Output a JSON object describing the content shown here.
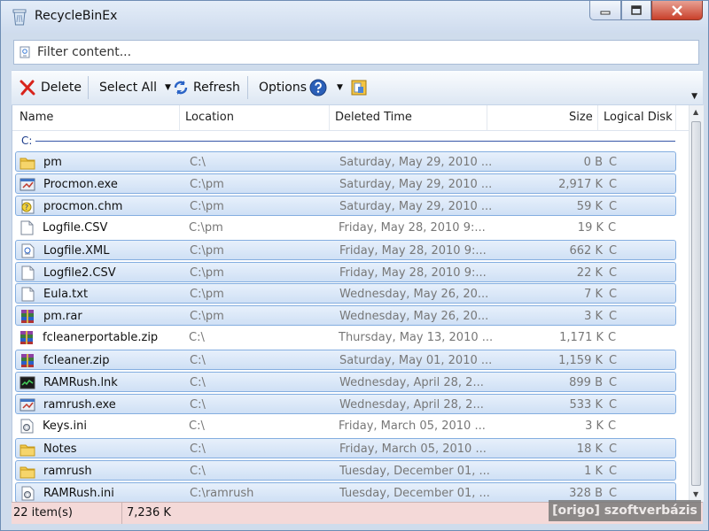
{
  "window": {
    "title": "RecycleBinEx"
  },
  "filter": {
    "placeholder": "Filter content..."
  },
  "toolbar": {
    "delete_label": "Delete",
    "select_all_label": "Select All",
    "refresh_label": "Refresh",
    "options_label": "Options"
  },
  "columns": {
    "name": "Name",
    "location": "Location",
    "deleted_time": "Deleted Time",
    "size": "Size",
    "disk": "Logical Disk"
  },
  "group_label": "C:",
  "files": [
    {
      "name": "pm",
      "location": "C:\\",
      "deleted": "Saturday, May 29, 2010 ...",
      "size": "0 B",
      "disk": "C",
      "icon": "folder-icon",
      "selected": true
    },
    {
      "name": "Procmon.exe",
      "location": "C:\\pm",
      "deleted": "Saturday, May 29, 2010 ...",
      "size": "2,917 K",
      "disk": "C",
      "icon": "exe-icon",
      "selected": true
    },
    {
      "name": "procmon.chm",
      "location": "C:\\pm",
      "deleted": "Saturday, May 29, 2010 ...",
      "size": "59 K",
      "disk": "C",
      "icon": "help-file-icon",
      "selected": true
    },
    {
      "name": "Logfile.CSV",
      "location": "C:\\pm",
      "deleted": "Friday, May 28, 2010 9:...",
      "size": "19 K",
      "disk": "C",
      "icon": "document-icon",
      "selected": false
    },
    {
      "name": "Logfile.XML",
      "location": "C:\\pm",
      "deleted": "Friday, May 28, 2010 9:...",
      "size": "662 K",
      "disk": "C",
      "icon": "xml-file-icon",
      "selected": true
    },
    {
      "name": "Logfile2.CSV",
      "location": "C:\\pm",
      "deleted": "Friday, May 28, 2010 9:...",
      "size": "22 K",
      "disk": "C",
      "icon": "document-icon",
      "selected": true
    },
    {
      "name": "Eula.txt",
      "location": "C:\\pm",
      "deleted": "Wednesday, May 26, 20...",
      "size": "7 K",
      "disk": "C",
      "icon": "document-icon",
      "selected": true
    },
    {
      "name": "pm.rar",
      "location": "C:\\pm",
      "deleted": "Wednesday, May 26, 20...",
      "size": "3 K",
      "disk": "C",
      "icon": "archive-icon",
      "selected": true
    },
    {
      "name": "fcleanerportable.zip",
      "location": "C:\\",
      "deleted": "Thursday, May 13, 2010 ...",
      "size": "1,171 K",
      "disk": "C",
      "icon": "archive-icon",
      "selected": false
    },
    {
      "name": "fcleaner.zip",
      "location": "C:\\",
      "deleted": "Saturday, May 01, 2010 ...",
      "size": "1,159 K",
      "disk": "C",
      "icon": "archive-icon",
      "selected": true
    },
    {
      "name": "RAMRush.lnk",
      "location": "C:\\",
      "deleted": "Wednesday, April 28, 2...",
      "size": "899 B",
      "disk": "C",
      "icon": "shortcut-icon",
      "selected": true
    },
    {
      "name": "ramrush.exe",
      "location": "C:\\",
      "deleted": "Wednesday, April 28, 2...",
      "size": "533 K",
      "disk": "C",
      "icon": "exe-icon",
      "selected": true
    },
    {
      "name": "Keys.ini",
      "location": "C:\\",
      "deleted": "Friday, March 05, 2010 ...",
      "size": "3 K",
      "disk": "C",
      "icon": "settings-file-icon",
      "selected": false
    },
    {
      "name": "Notes",
      "location": "C:\\",
      "deleted": "Friday, March 05, 2010 ...",
      "size": "18 K",
      "disk": "C",
      "icon": "folder-icon",
      "selected": true
    },
    {
      "name": "ramrush",
      "location": "C:\\",
      "deleted": "Tuesday, December 01, ...",
      "size": "1 K",
      "disk": "C",
      "icon": "folder-icon",
      "selected": true
    },
    {
      "name": "RAMRush.ini",
      "location": "C:\\ramrush",
      "deleted": "Tuesday, December 01, ...",
      "size": "328 B",
      "disk": "C",
      "icon": "settings-file-icon",
      "selected": true
    }
  ],
  "status": {
    "count": "22 item(s)",
    "total": "7,236 K"
  },
  "watermark": "[origo] szoftverbázis",
  "colors": {
    "selection": "#cfe0f5",
    "selection_border": "#84aee0",
    "close_button": "#c9402a",
    "status_bar": "#f4d9d8"
  }
}
